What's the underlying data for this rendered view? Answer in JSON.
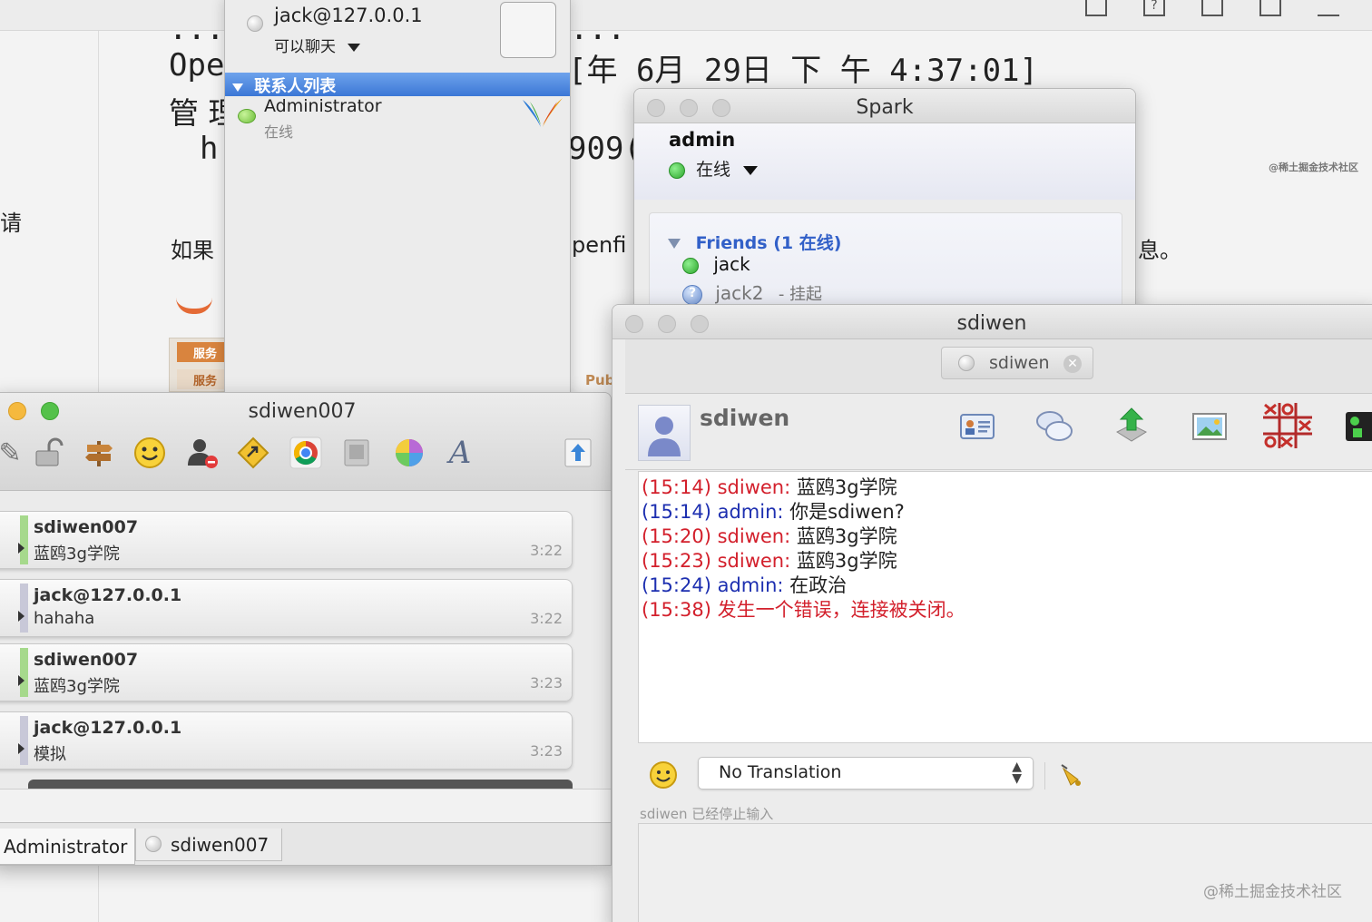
{
  "background": {
    "line1_left": "...",
    "line1_right": "...",
    "line2_left": "Ope",
    "line2_right": "[年 6月 29日  下 午 4:37:01]",
    "line3_left": "管 理",
    "line4_left": "h",
    "line4_right": "909(",
    "left_char": "请",
    "line5_left": "如果",
    "line5_mid": "penfi",
    "line5_right": "息。",
    "orange_tab1": "服务",
    "orange_tab2": "服务",
    "pub_text": "Pub",
    "watermark_small": "@稀土掘金技术社区"
  },
  "contacts_window": {
    "account": "jack@127.0.0.1",
    "status": "可以聊天",
    "list_header": "联系人列表",
    "contact_name": "Administrator",
    "contact_status": "在线"
  },
  "spark_window": {
    "title": "Spark",
    "user": "admin",
    "status": "在线",
    "group_label": "Friends (1 在线)",
    "friends": [
      {
        "name": "jack",
        "note": ""
      },
      {
        "name": "jack2",
        "note": "- 挂起"
      }
    ]
  },
  "sdiwen007_window": {
    "title": "sdiwen007",
    "toolbar_icons": [
      "pen-icon",
      "unlock-icon",
      "signpost-icon",
      "smiley-icon",
      "block-user-icon",
      "send-file-icon",
      "chrome-icon",
      "tape-icon",
      "color-wheel-icon",
      "font-icon",
      "upload-icon"
    ],
    "messages": [
      {
        "name": "sdiwen007",
        "text": "蓝鸥3g学院",
        "time": "3:22",
        "accent": "#a6d98c"
      },
      {
        "name": "jack@127.0.0.1",
        "text": "hahaha",
        "time": "3:22",
        "accent": "#c8c8d8"
      },
      {
        "name": "sdiwen007",
        "text": "蓝鸥3g学院",
        "time": "3:23",
        "accent": "#a6d98c"
      },
      {
        "name": "jack@127.0.0.1",
        "text": "模拟",
        "time": "3:23",
        "accent": "#c8c8d8"
      }
    ],
    "tabs": [
      "Administrator",
      "sdiwen007"
    ]
  },
  "chat_window": {
    "title": "sdiwen",
    "tab_label": "sdiwen",
    "contact_name": "sdiwen",
    "toolbar_icons": [
      "profile-card-icon",
      "chat-bubbles-icon",
      "download-icon",
      "image-icon",
      "tictactoe-icon",
      "status-icon"
    ],
    "transcript": [
      {
        "time": "(15:14)",
        "who": "sdiwen:",
        "text": "蓝鸥3g学院",
        "color": "red"
      },
      {
        "time": "(15:14)",
        "who": "admin:",
        "text": "你是sdiwen?",
        "color": "blue"
      },
      {
        "time": "(15:20)",
        "who": "sdiwen:",
        "text": "蓝鸥3g学院",
        "color": "red"
      },
      {
        "time": "(15:23)",
        "who": "sdiwen:",
        "text": "蓝鸥3g学院",
        "color": "red"
      },
      {
        "time": "(15:24)",
        "who": "admin:",
        "text": "在政治",
        "color": "blue"
      },
      {
        "time": "(15:38)",
        "who": "",
        "text": "发生一个错误，连接被关闭。",
        "color": "red"
      }
    ],
    "translation_select": "No Translation",
    "typing_status": "sdiwen 已经停止输入",
    "watermark": "@稀土掘金技术社区"
  },
  "colors": {
    "accent_blue": "#3c74d2",
    "chat_red": "#d3202c",
    "chat_blue": "#1d2fb0",
    "online_green": "#2ca62c"
  }
}
